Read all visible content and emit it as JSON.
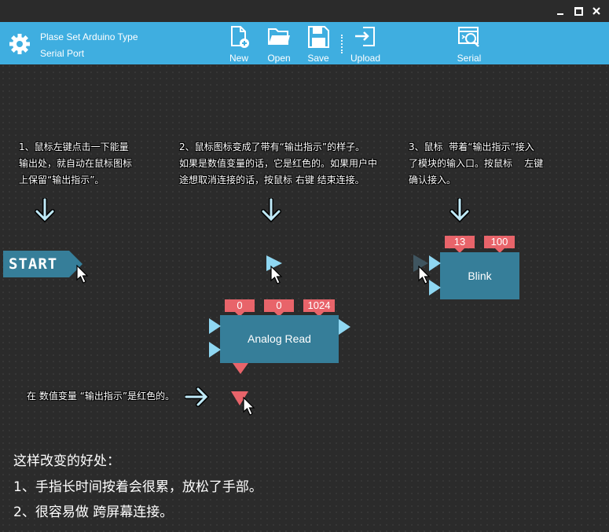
{
  "toolbar": {
    "title_line1": "Plase Set Arduino Type",
    "title_line2": "Serial Port",
    "buttons": {
      "new": "New",
      "open": "Open",
      "save": "Save",
      "upload": "Upload",
      "serial": "Serial"
    },
    "bg_color": "#3faee0"
  },
  "window_controls": [
    "minimize",
    "maximize",
    "close"
  ],
  "notes": {
    "step1": "1、鼠标左键点击一下能量\n输出处，就自动在鼠标图标\n上保留“输出指示”。",
    "step2": "2、鼠标图标变成了带有“输出指示”的样子。\n如果是数值变量的话，它是红色的。如果用户中\n途想取消连接的话，按鼠标 右键 结束连接。",
    "step3": "3、鼠标  带着“输出指示”接入\n了模块的输入口。按鼠标    左键\n确认接入。",
    "red_hint": "在 数值变量 “输出指示”是红色的。"
  },
  "start_block": {
    "label": "START",
    "color": "#367e99"
  },
  "analog_block": {
    "title": "Analog Read",
    "params": [
      "0",
      "0",
      "1024"
    ],
    "color": "#367e99"
  },
  "blink_block": {
    "title": "Blink",
    "params": [
      "13",
      "100"
    ]
  },
  "param_color": "#e8646a",
  "port_color": "#8fd7f2",
  "bottom": {
    "heading": "这样改变的好处：",
    "point1": "1、手指长时间按着会很累，放松了手部。",
    "point2": "2、很容易做 跨屏幕连接。"
  }
}
